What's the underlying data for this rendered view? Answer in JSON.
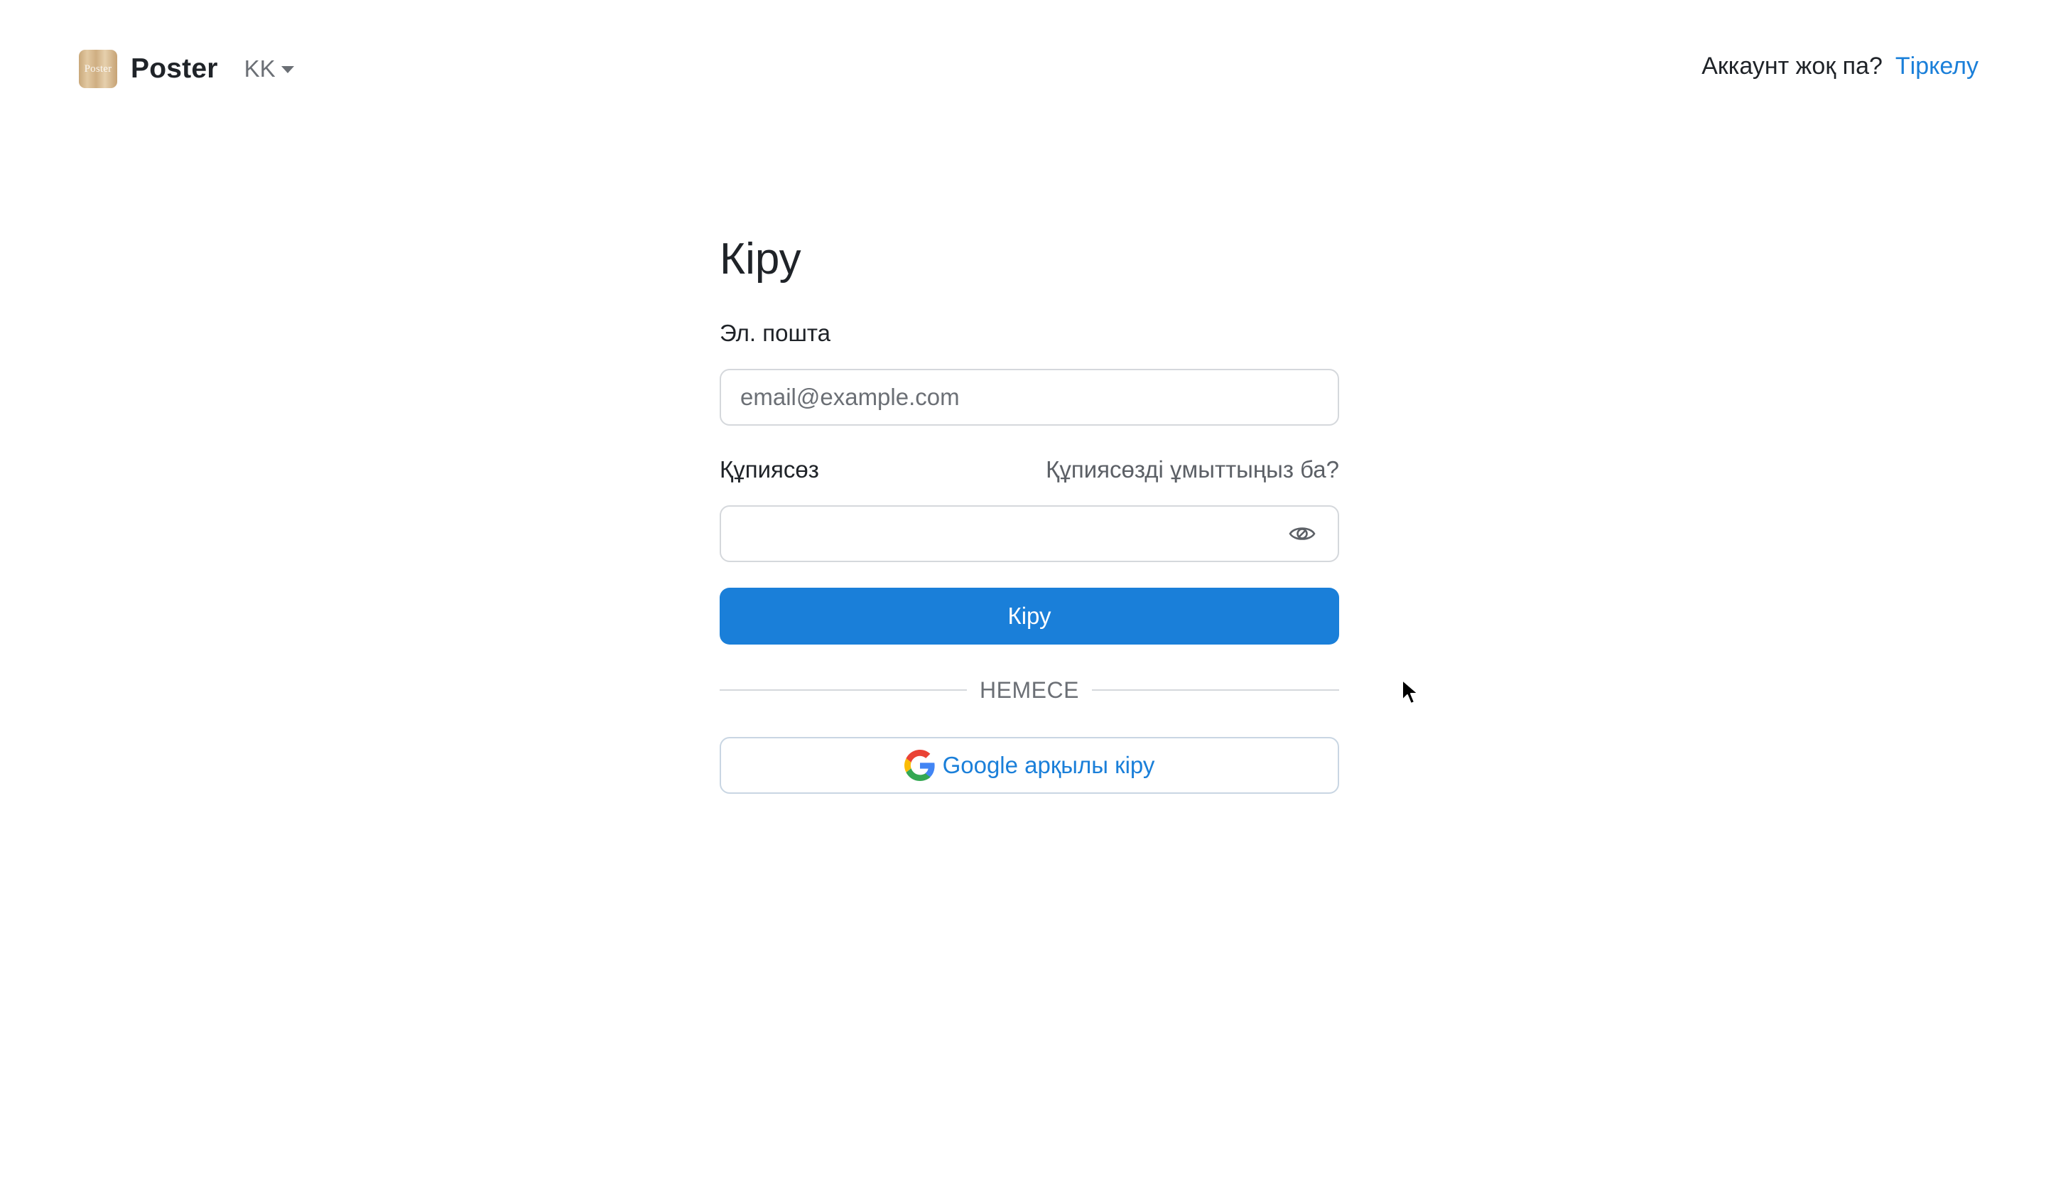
{
  "header": {
    "logo_text": "Poster",
    "brand_name": "Poster",
    "language": "KK",
    "account_question": "Аккаунт жоқ па?",
    "signup_link": "Тіркелу"
  },
  "form": {
    "title": "Кіру",
    "email_label": "Эл. пошта",
    "email_placeholder": "email@example.com",
    "email_value": "",
    "password_label": "Құпиясөз",
    "forgot_link": "Құпиясөзді ұмыттыңыз ба?",
    "password_value": "",
    "submit_label": "Кіру",
    "divider_text": "НЕМЕСЕ",
    "google_label": "Google арқылы кіру"
  },
  "icons": {
    "logo": "poster-logo-icon",
    "language_caret": "caret-down-icon",
    "password_toggle": "eye-icon",
    "google": "google-icon",
    "cursor": "mouse-cursor-icon"
  },
  "colors": {
    "accent": "#1a7fd9",
    "text": "#1f2328",
    "muted": "#6b6f75",
    "border": "#d5d8dc"
  }
}
